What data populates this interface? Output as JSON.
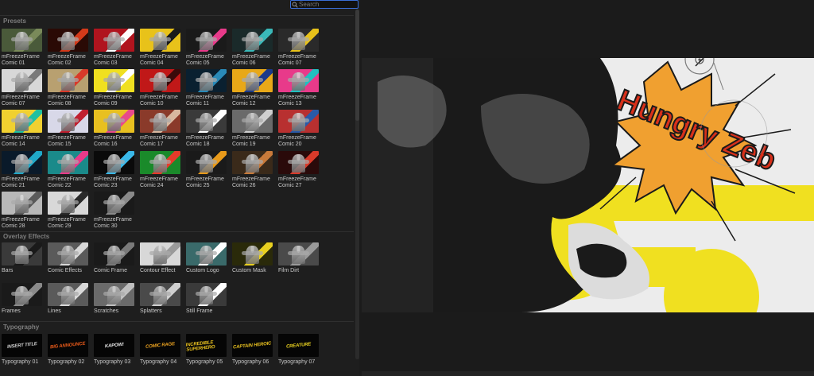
{
  "search": {
    "placeholder": "Search",
    "value": ""
  },
  "sections": {
    "presets": "Presets",
    "overlay": "Overlay Effects",
    "typography": "Typography"
  },
  "presets": [
    {
      "label": "mFreezeFrame Comic 01",
      "bg": "#4a5a3a",
      "accent": "#7a8a5a"
    },
    {
      "label": "mFreezeFrame Comic 02",
      "bg": "#2a0a05",
      "accent": "#d43a1a"
    },
    {
      "label": "mFreezeFrame Comic 03",
      "bg": "#b0141e",
      "accent": "#ffffff"
    },
    {
      "label": "mFreezeFrame Comic 04",
      "bg": "#e8c21a",
      "accent": "#1a1a1a"
    },
    {
      "label": "mFreezeFrame Comic 05",
      "bg": "#1a1a1a",
      "accent": "#e83a8a"
    },
    {
      "label": "mFreezeFrame Comic 06",
      "bg": "#1a2a2a",
      "accent": "#3ab8b8"
    },
    {
      "label": "mFreezeFrame Comic 07",
      "bg": "#2a2a2a",
      "accent": "#e8c21a"
    },
    {
      "label": "mFreezeFrame Comic 07",
      "bg": "#d8d8d8",
      "accent": "#7a7a7a"
    },
    {
      "label": "mFreezeFrame Comic 08",
      "bg": "#b8a070",
      "accent": "#d83a2a"
    },
    {
      "label": "mFreezeFrame Comic 09",
      "bg": "#f0e020",
      "accent": "#ffffff"
    },
    {
      "label": "mFreezeFrame Comic 10",
      "bg": "#c01818",
      "accent": "#3a0a0a"
    },
    {
      "label": "mFreezeFrame Comic 11",
      "bg": "#0a2030",
      "accent": "#2a8ab8"
    },
    {
      "label": "mFreezeFrame Comic 12",
      "bg": "#e8a818",
      "accent": "#1a3a8a"
    },
    {
      "label": "mFreezeFrame Comic 13",
      "bg": "#e83a8a",
      "accent": "#20c0c0"
    },
    {
      "label": "mFreezeFrame Comic 14",
      "bg": "#f0d030",
      "accent": "#20c0a0"
    },
    {
      "label": "mFreezeFrame Comic 15",
      "bg": "#d8d8e8",
      "accent": "#c02030"
    },
    {
      "label": "mFreezeFrame Comic 16",
      "bg": "#e8c020",
      "accent": "#e84a8a"
    },
    {
      "label": "mFreezeFrame Comic 17",
      "bg": "#8a3a2a",
      "accent": "#d8b8a0"
    },
    {
      "label": "mFreezeFrame Comic 18",
      "bg": "#3a3a3a",
      "accent": "#ffffff"
    },
    {
      "label": "mFreezeFrame Comic 19",
      "bg": "#6a6a6a",
      "accent": "#cfcfcf"
    },
    {
      "label": "mFreezeFrame Comic 20",
      "bg": "#b83030",
      "accent": "#2a5aa8"
    },
    {
      "label": "mFreezeFrame Comic 21",
      "bg": "#0a1a2a",
      "accent": "#20a8c8"
    },
    {
      "label": "mFreezeFrame Comic 22",
      "bg": "#1a8a8a",
      "accent": "#e83a8a"
    },
    {
      "label": "mFreezeFrame Comic 23",
      "bg": "#0a0a0a",
      "accent": "#3ab8e8"
    },
    {
      "label": "mFreezeFrame Comic 24",
      "bg": "#1a8a2a",
      "accent": "#e83a2a"
    },
    {
      "label": "mFreezeFrame Comic 25",
      "bg": "#1a1a1a",
      "accent": "#e89a1a"
    },
    {
      "label": "mFreezeFrame Comic 26",
      "bg": "#3a2a1a",
      "accent": "#c87a3a"
    },
    {
      "label": "mFreezeFrame Comic 27",
      "bg": "#2a0a0a",
      "accent": "#d83a2a"
    },
    {
      "label": "mFreezeFrame Comic 28",
      "bg": "#b8b8b8",
      "accent": "#5a5a5a"
    },
    {
      "label": "mFreezeFrame Comic 29",
      "bg": "#d8d8d8",
      "accent": "#2a2a2a"
    },
    {
      "label": "mFreezeFrame Comic 30",
      "bg": "#1a1a1a",
      "accent": "#8a8a8a"
    }
  ],
  "overlays": [
    {
      "label": "Bars",
      "bg": "#3a3a3a",
      "accent": "#1a1a1a"
    },
    {
      "label": "Comic Effects",
      "bg": "#5a5a5a",
      "accent": "#d8d8d8"
    },
    {
      "label": "Comic Frame",
      "bg": "#1a1a1a",
      "accent": "#7a7a7a"
    },
    {
      "label": "Contour Effect",
      "bg": "#d8d8d8",
      "accent": "#9a9a9a"
    },
    {
      "label": "Custom Logo",
      "bg": "#3a6a6a",
      "accent": "#ffffff"
    },
    {
      "label": "Custom Mask",
      "bg": "#2a2a0a",
      "accent": "#e8d020"
    },
    {
      "label": "Film Dirt",
      "bg": "#4a4a4a",
      "accent": "#9a9a9a"
    },
    {
      "label": "Frames",
      "bg": "#1a1a1a",
      "accent": "#8a8a8a"
    },
    {
      "label": "Lines",
      "bg": "#5a5a5a",
      "accent": "#d8d8d8"
    },
    {
      "label": "Scratches",
      "bg": "#6a6a6a",
      "accent": "#bfbfbf"
    },
    {
      "label": "Splatters",
      "bg": "#4a4a4a",
      "accent": "#cfcfcf"
    },
    {
      "label": "Still Frame",
      "bg": "#3a3a3a",
      "accent": "#ffffff"
    }
  ],
  "typography": [
    {
      "label": "Typography 01",
      "text": "INSERT TITLE",
      "color": "#cfcfcf"
    },
    {
      "label": "Typography 02",
      "text": "BIG ANNOUNCE",
      "color": "#e85a1a"
    },
    {
      "label": "Typography 03",
      "text": "KAPOW!",
      "color": "#e8e8e8"
    },
    {
      "label": "Typography 04",
      "text": "COMIC RAGE",
      "color": "#e8a020"
    },
    {
      "label": "Typography 05",
      "text": "INCREDIBLE SUPERHERO",
      "color": "#e8c020"
    },
    {
      "label": "Typography 06",
      "text": "CAPTAIN HEROIC",
      "color": "#e8c020"
    },
    {
      "label": "Typography 07",
      "text": "CREATURE",
      "color": "#e8d020"
    }
  ],
  "viewer": {
    "title_text": "Hungry Zeb",
    "colors": {
      "yellow": "#f0e020",
      "red": "#d8301a",
      "orange": "#f0a030",
      "background": "#ececec",
      "dark": "#1a1a1a"
    }
  }
}
